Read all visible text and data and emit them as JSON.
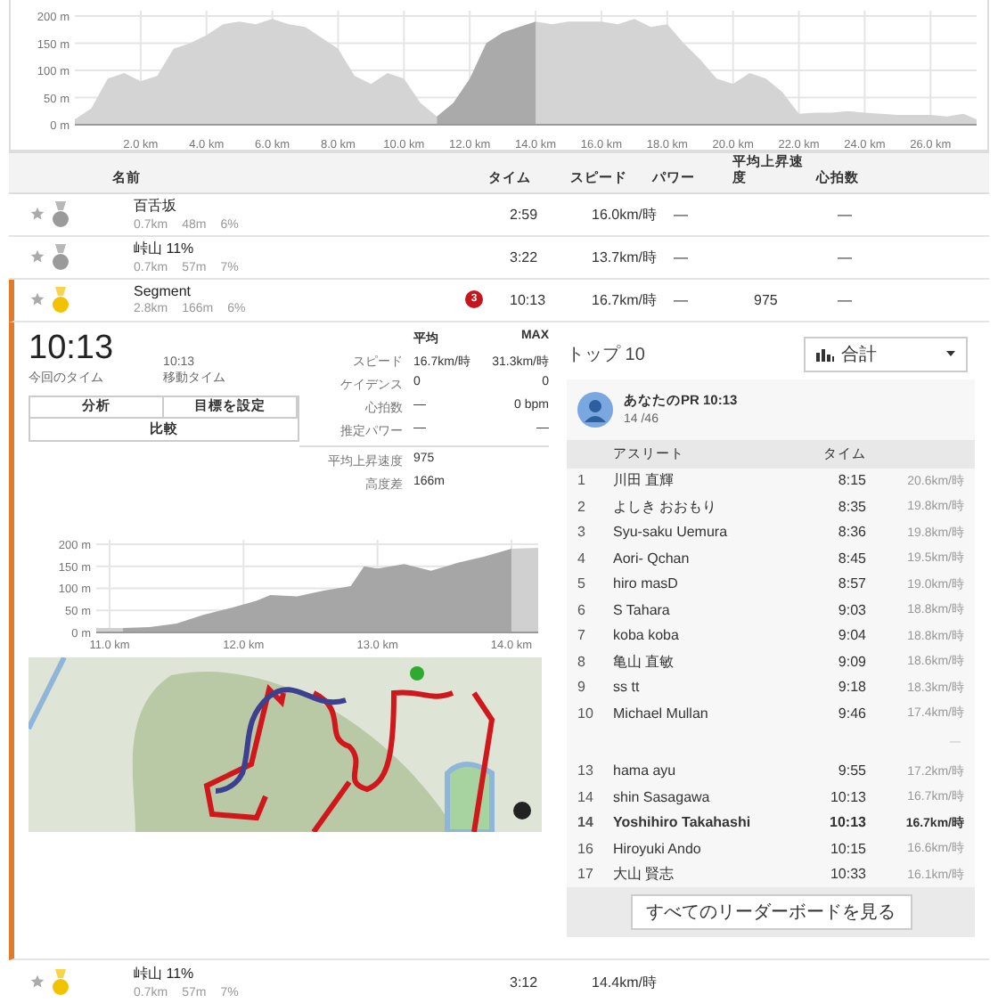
{
  "overview_chart": {
    "chart_data": {
      "type": "area",
      "xlim": [
        0,
        27.4
      ],
      "ylim": [
        0,
        210
      ],
      "grid": true,
      "yticks": [
        {
          "value": 0,
          "label": "0 m"
        },
        {
          "value": 50,
          "label": "50 m"
        },
        {
          "value": 100,
          "label": "100 m"
        },
        {
          "value": 150,
          "label": "150 m"
        },
        {
          "value": 200,
          "label": "200 m"
        }
      ],
      "xticks": [
        {
          "value": 2,
          "label": "2.0 km"
        },
        {
          "value": 4,
          "label": "4.0 km"
        },
        {
          "value": 6,
          "label": "6.0 km"
        },
        {
          "value": 8,
          "label": "8.0 km"
        },
        {
          "value": 10,
          "label": "10.0 km"
        },
        {
          "value": 12,
          "label": "12.0 km"
        },
        {
          "value": 14,
          "label": "14.0 km"
        },
        {
          "value": 16,
          "label": "16.0 km"
        },
        {
          "value": 18,
          "label": "18.0 km"
        },
        {
          "value": 20,
          "label": "20.0 km"
        },
        {
          "value": 22,
          "label": "22.0 km"
        },
        {
          "value": 24,
          "label": "24.0 km"
        },
        {
          "value": 26,
          "label": "26.0 km"
        }
      ],
      "x": [
        0,
        0.5,
        1,
        1.5,
        2,
        2.5,
        3,
        3.5,
        4,
        4.5,
        5,
        5.5,
        6,
        6.5,
        7,
        7.5,
        8,
        8.5,
        9,
        9.5,
        10,
        10.5,
        11,
        11.5,
        12,
        12.5,
        13,
        13.5,
        14,
        14.5,
        15,
        15.5,
        16,
        16.5,
        17,
        17.5,
        18,
        18.5,
        19,
        19.5,
        20,
        20.5,
        21,
        21.5,
        22,
        22.5,
        23,
        23.5,
        24,
        24.5,
        25,
        25.5,
        26,
        26.5,
        27,
        27.4
      ],
      "series": [
        {
          "color": "#d4d4d4",
          "values": [
            10,
            30,
            85,
            95,
            80,
            90,
            140,
            150,
            165,
            185,
            190,
            185,
            195,
            185,
            180,
            160,
            140,
            90,
            75,
            95,
            85,
            40,
            15,
            null,
            null,
            null,
            null,
            null,
            190,
            185,
            190,
            190,
            190,
            185,
            195,
            180,
            185,
            150,
            120,
            85,
            75,
            95,
            85,
            60,
            20,
            22,
            22,
            25,
            22,
            20,
            18,
            18,
            18,
            15,
            20,
            10
          ]
        },
        {
          "color": "#aaaaaa",
          "values": [
            null,
            null,
            null,
            null,
            null,
            null,
            null,
            null,
            null,
            null,
            null,
            null,
            null,
            null,
            null,
            null,
            null,
            null,
            null,
            null,
            null,
            null,
            15,
            40,
            85,
            150,
            170,
            180,
            190,
            null,
            null,
            null,
            null,
            null,
            null,
            null,
            null,
            null,
            null,
            null,
            null,
            null,
            null,
            null,
            null,
            null,
            null,
            null,
            null,
            null,
            null,
            null,
            null,
            null,
            null,
            null
          ]
        }
      ]
    }
  },
  "segment_table": {
    "columns": [
      "名前",
      "タイム",
      "スピード",
      "パワー",
      "平均上昇速度",
      "心拍数"
    ],
    "rows": [
      {
        "name": "百舌坂",
        "stats": [
          "0.7km",
          "48m",
          "6%"
        ],
        "color": "#9a9a9a",
        "time": "2:59",
        "speed": "16.0km/時",
        "power": "—",
        "hr": "—",
        "expanded": false
      },
      {
        "name": "峠山 11%",
        "stats": [
          "0.7km",
          "57m",
          "7%"
        ],
        "color": "#9a9a9a",
        "time": "3:22",
        "speed": "13.7km/時",
        "power": "—",
        "hr": "—",
        "expanded": false
      },
      {
        "name": "Segment",
        "stats": [
          "2.8km",
          "166m",
          "6%"
        ],
        "color": "#f2c200",
        "badge": "3",
        "time": "10:13",
        "speed": "16.7km/時",
        "power": "—",
        "climb": "975",
        "hr": "—",
        "expanded": true
      }
    ]
  },
  "segment_detail": {
    "elapsed_time": "10:13",
    "elapsed_label": "今回のタイム",
    "moving_time": "10:13",
    "moving_label": "移動タイム",
    "buttons": [
      "分析",
      "目標を設定",
      "比較"
    ],
    "stats_columns": [
      "平均",
      "MAX"
    ],
    "stats": [
      {
        "label": "スピード",
        "avg": "16.7km/時",
        "max": "31.3km/時"
      },
      {
        "label": "ケイデンス",
        "avg": "0",
        "max": "0"
      },
      {
        "label": "心拍数",
        "avg": "—",
        "max": "0 bpm"
      },
      {
        "label": "推定パワー",
        "avg": "—",
        "max": "—"
      }
    ],
    "extra_stats": [
      {
        "label": "平均上昇速度",
        "value": "975"
      },
      {
        "label": "高度差",
        "value": "166m"
      }
    ],
    "chart_data": {
      "type": "area",
      "xlim": [
        10.9,
        14.2
      ],
      "ylim": [
        0,
        210
      ],
      "grid": true,
      "yticks": [
        {
          "value": 0,
          "label": "0 m"
        },
        {
          "value": 50,
          "label": "50 m"
        },
        {
          "value": 100,
          "label": "100 m"
        },
        {
          "value": 150,
          "label": "150 m"
        },
        {
          "value": 200,
          "label": "200 m"
        }
      ],
      "xticks": [
        {
          "value": 11,
          "label": "11.0 km"
        },
        {
          "value": 12,
          "label": "12.0 km"
        },
        {
          "value": 13,
          "label": "13.0 km"
        },
        {
          "value": 14,
          "label": "14.0 km"
        }
      ],
      "x": [
        10.9,
        11.1,
        11.3,
        11.5,
        11.7,
        11.9,
        12.1,
        12.2,
        12.4,
        12.6,
        12.8,
        12.9,
        13.0,
        13.2,
        13.4,
        13.6,
        13.8,
        14.0,
        14.2
      ],
      "series": [
        {
          "color": "#d0d0d0",
          "values": [
            10,
            10,
            null,
            null,
            null,
            null,
            null,
            null,
            null,
            null,
            null,
            null,
            null,
            null,
            null,
            null,
            null,
            190,
            192
          ]
        },
        {
          "color": "#a6a6a6",
          "values": [
            null,
            10,
            12,
            20,
            40,
            55,
            72,
            85,
            82,
            95,
            105,
            150,
            145,
            155,
            140,
            158,
            172,
            190,
            null
          ]
        }
      ]
    }
  },
  "leaderboard": {
    "title": "トップ 10",
    "filter": "合計",
    "pr_label": "あなたのPR 10:13",
    "pr_rank": "14 /46",
    "columns": [
      "アスリート",
      "タイム"
    ],
    "rows": [
      {
        "kind": "athlete",
        "rank": "1",
        "name": "川田 直輝",
        "time": "8:15",
        "speed": "20.6km/時",
        "selected": false
      },
      {
        "kind": "athlete",
        "rank": "2",
        "name": "よしき おおもり",
        "time": "8:35",
        "speed": "19.8km/時",
        "selected": false
      },
      {
        "kind": "athlete",
        "rank": "3",
        "name": "Syu-saku Uemura",
        "time": "8:36",
        "speed": "19.8km/時",
        "selected": false
      },
      {
        "kind": "athlete",
        "rank": "4",
        "name": "Aori- Qchan",
        "time": "8:45",
        "speed": "19.5km/時",
        "selected": false
      },
      {
        "kind": "athlete",
        "rank": "5",
        "name": "hiro masD",
        "time": "8:57",
        "speed": "19.0km/時",
        "selected": false
      },
      {
        "kind": "athlete",
        "rank": "6",
        "name": "S Tahara",
        "time": "9:03",
        "speed": "18.8km/時",
        "selected": false
      },
      {
        "kind": "athlete",
        "rank": "7",
        "name": "koba koba",
        "time": "9:04",
        "speed": "18.8km/時",
        "selected": false
      },
      {
        "kind": "athlete",
        "rank": "8",
        "name": "亀山 直敏",
        "time": "9:09",
        "speed": "18.6km/時",
        "selected": false
      },
      {
        "kind": "athlete",
        "rank": "9",
        "name": "ss tt",
        "time": "9:18",
        "speed": "18.3km/時",
        "selected": false
      },
      {
        "kind": "athlete",
        "rank": "10",
        "name": "Michael Mullan",
        "time": "9:46",
        "speed": "17.4km/時",
        "selected": false
      },
      {
        "kind": "gap",
        "mark": "—"
      },
      {
        "kind": "athlete",
        "rank": "13",
        "name": "hama ayu",
        "time": "9:55",
        "speed": "17.2km/時",
        "selected": false
      },
      {
        "kind": "athlete",
        "rank": "14",
        "name": "shin Sasagawa",
        "time": "10:13",
        "speed": "16.7km/時",
        "selected": false
      },
      {
        "kind": "athlete",
        "rank": "14",
        "name": "Yoshihiro Takahashi",
        "time": "10:13",
        "speed": "16.7km/時",
        "selected": true
      },
      {
        "kind": "athlete",
        "rank": "16",
        "name": "Hiroyuki Ando",
        "time": "10:15",
        "speed": "16.6km/時",
        "selected": false
      },
      {
        "kind": "athlete",
        "rank": "17",
        "name": "大山 賢志",
        "time": "10:33",
        "speed": "16.1km/時",
        "selected": false
      }
    ],
    "button": "すべてのリーダーボードを見る"
  },
  "next_row": {
    "name": "峠山 11%",
    "stats": [
      "0.7km",
      "57m",
      "7%"
    ],
    "color": "#f2c200",
    "time": "3:12",
    "speed": "14.4km/時"
  }
}
